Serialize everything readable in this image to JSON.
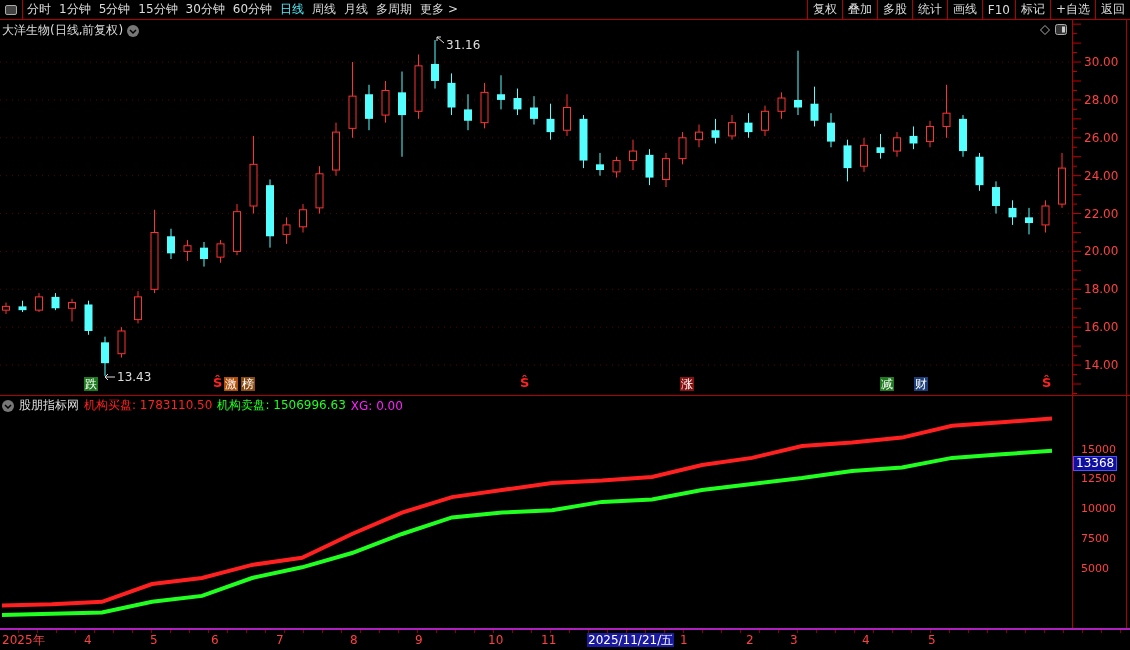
{
  "toolbar": {
    "tabs": [
      {
        "label": "分时",
        "selected": false
      },
      {
        "label": "1分钟",
        "selected": false
      },
      {
        "label": "5分钟",
        "selected": false
      },
      {
        "label": "15分钟",
        "selected": false
      },
      {
        "label": "30分钟",
        "selected": false
      },
      {
        "label": "60分钟",
        "selected": false
      },
      {
        "label": "日线",
        "selected": true
      },
      {
        "label": "周线",
        "selected": false
      },
      {
        "label": "月线",
        "selected": false
      },
      {
        "label": "多周期",
        "selected": false
      },
      {
        "label": "更多 >",
        "selected": false
      }
    ],
    "buttons": [
      "复权",
      "叠加",
      "多股",
      "统计",
      "画线",
      "F10",
      "标记",
      "+自选",
      "返回"
    ]
  },
  "price_panel": {
    "title": "大洋生物(日线,前复权)",
    "high_label": "31.16",
    "low_label": "13.43",
    "chart_data": {
      "type": "candlestick",
      "ylim": [
        12.42,
        32.22
      ],
      "grid": true,
      "yticks": [
        {
          "value": 30,
          "label": "30.00"
        },
        {
          "value": 28,
          "label": "28.00"
        },
        {
          "value": 26,
          "label": "26.00"
        },
        {
          "value": 24,
          "label": "24.00"
        },
        {
          "value": 22,
          "label": "22.00"
        },
        {
          "value": 20,
          "label": "20.00"
        },
        {
          "value": 18,
          "label": "18.00"
        },
        {
          "value": 16,
          "label": "16.00"
        },
        {
          "value": 14,
          "label": "14.00"
        }
      ],
      "ohlc": [
        [
          16.9,
          17.3,
          16.7,
          17.1
        ],
        [
          17.1,
          17.4,
          16.8,
          16.9
        ],
        [
          16.9,
          17.8,
          16.8,
          17.6
        ],
        [
          17.6,
          17.8,
          16.9,
          17.0
        ],
        [
          17.0,
          17.5,
          16.3,
          17.3
        ],
        [
          17.2,
          17.4,
          15.6,
          15.8
        ],
        [
          15.2,
          15.5,
          13.43,
          14.1
        ],
        [
          14.6,
          16.0,
          14.4,
          15.8
        ],
        [
          16.4,
          17.9,
          16.2,
          17.6
        ],
        [
          18.0,
          22.2,
          17.8,
          21.0
        ],
        [
          20.8,
          21.2,
          19.6,
          19.9
        ],
        [
          20.0,
          20.6,
          19.5,
          20.3
        ],
        [
          20.2,
          20.5,
          19.2,
          19.6
        ],
        [
          19.7,
          20.6,
          19.4,
          20.4
        ],
        [
          20.0,
          22.5,
          19.8,
          22.1
        ],
        [
          22.4,
          26.1,
          22.0,
          24.6
        ],
        [
          23.5,
          23.8,
          20.2,
          20.8
        ],
        [
          20.9,
          21.8,
          20.4,
          21.4
        ],
        [
          21.3,
          22.5,
          21.0,
          22.2
        ],
        [
          22.3,
          24.5,
          22.0,
          24.1
        ],
        [
          24.3,
          26.8,
          24.0,
          26.3
        ],
        [
          26.5,
          30.0,
          26.0,
          28.2
        ],
        [
          28.3,
          28.8,
          26.4,
          27.0
        ],
        [
          27.2,
          29.0,
          26.8,
          28.5
        ],
        [
          28.4,
          29.5,
          25.0,
          27.2
        ],
        [
          27.4,
          30.4,
          27.0,
          29.8
        ],
        [
          29.9,
          31.16,
          28.6,
          29.0
        ],
        [
          28.9,
          29.4,
          27.2,
          27.6
        ],
        [
          27.5,
          28.3,
          26.4,
          26.9
        ],
        [
          26.8,
          28.9,
          26.5,
          28.4
        ],
        [
          28.3,
          29.3,
          27.5,
          28.0
        ],
        [
          28.1,
          28.6,
          27.2,
          27.5
        ],
        [
          27.6,
          28.2,
          26.7,
          27.0
        ],
        [
          27.0,
          27.8,
          25.9,
          26.3
        ],
        [
          26.4,
          28.3,
          26.1,
          27.6
        ],
        [
          27.0,
          27.2,
          24.4,
          24.8
        ],
        [
          24.6,
          25.2,
          24.0,
          24.3
        ],
        [
          24.2,
          25.0,
          23.9,
          24.8
        ],
        [
          24.8,
          25.9,
          24.3,
          25.3
        ],
        [
          25.1,
          25.4,
          23.5,
          23.9
        ],
        [
          23.8,
          25.2,
          23.4,
          24.9
        ],
        [
          24.9,
          26.3,
          24.6,
          26.0
        ],
        [
          25.9,
          26.7,
          25.5,
          26.3
        ],
        [
          26.4,
          27.0,
          25.7,
          26.0
        ],
        [
          26.1,
          27.2,
          25.9,
          26.8
        ],
        [
          26.8,
          27.3,
          26.0,
          26.3
        ],
        [
          26.4,
          27.7,
          26.1,
          27.4
        ],
        [
          27.4,
          28.4,
          27.0,
          28.1
        ],
        [
          28.0,
          30.6,
          27.2,
          27.6
        ],
        [
          27.8,
          28.7,
          26.6,
          26.9
        ],
        [
          26.8,
          27.3,
          25.5,
          25.8
        ],
        [
          25.6,
          25.9,
          23.7,
          24.4
        ],
        [
          24.5,
          26.0,
          24.2,
          25.6
        ],
        [
          25.5,
          26.2,
          24.9,
          25.2
        ],
        [
          25.3,
          26.3,
          25.0,
          26.0
        ],
        [
          26.1,
          26.6,
          25.4,
          25.7
        ],
        [
          25.8,
          26.9,
          25.5,
          26.6
        ],
        [
          26.6,
          28.8,
          26.0,
          27.3
        ],
        [
          27.0,
          27.2,
          25.0,
          25.3
        ],
        [
          25.0,
          25.2,
          23.2,
          23.5
        ],
        [
          23.4,
          23.7,
          22.0,
          22.4
        ],
        [
          22.3,
          22.7,
          21.4,
          21.8
        ],
        [
          21.8,
          22.3,
          20.9,
          21.5
        ],
        [
          21.4,
          22.7,
          21.0,
          22.4
        ],
        [
          22.5,
          25.2,
          22.3,
          24.4
        ]
      ]
    },
    "signals": [
      {
        "text": "跌",
        "kind": "badge",
        "color": "#1e7a1e"
      },
      {
        "text": "Ŝ",
        "kind": "sign",
        "color": "#ff2020"
      },
      {
        "text": "激",
        "kind": "badge",
        "color": "#b0500a"
      },
      {
        "text": "榜",
        "kind": "badge",
        "color": "#8a4a10"
      },
      {
        "text": "Ŝ",
        "kind": "sign",
        "color": "#ff2020"
      },
      {
        "text": "涨",
        "kind": "badge",
        "color": "#8a1010"
      },
      {
        "text": "减",
        "kind": "badge",
        "color": "#1e7a1e"
      },
      {
        "text": "财",
        "kind": "badge",
        "color": "#1c3f7a"
      },
      {
        "text": "Ŝ",
        "kind": "sign",
        "color": "#ff2020"
      }
    ]
  },
  "indicator_panel": {
    "name": "股朋指标网",
    "legend": [
      {
        "text": "机构买盘: 1783110.50",
        "color": "#ff2020"
      },
      {
        "text": "机构卖盘: 1506996.63",
        "color": "#20ff20"
      },
      {
        "text": "XG: 0.00",
        "color": "#ff20ff"
      }
    ],
    "current_value": "13368",
    "chart_data": {
      "type": "line",
      "ylim": [
        0,
        19500
      ],
      "yticks": [
        {
          "value": 15000,
          "label": "15000"
        },
        {
          "value": 12500,
          "label": "12500"
        },
        {
          "value": 10000,
          "label": "10000"
        },
        {
          "value": 7500,
          "label": "7500"
        },
        {
          "value": 5000,
          "label": "5000"
        }
      ],
      "series": [
        {
          "color": "#ff2020",
          "values": [
            1900,
            2000,
            2200,
            3700,
            4200,
            5300,
            5900,
            7900,
            9700,
            11000,
            11600,
            12200,
            12400,
            12700,
            13700,
            14300,
            15300,
            15600,
            16000,
            17000,
            17300,
            17600
          ]
        },
        {
          "color": "#20ff20",
          "values": [
            1100,
            1200,
            1300,
            2200,
            2700,
            4200,
            5100,
            6300,
            7900,
            9300,
            9700,
            9900,
            10600,
            10800,
            11600,
            12100,
            12600,
            13200,
            13500,
            14300,
            14600,
            14900
          ]
        }
      ]
    }
  },
  "date_axis": [
    {
      "label": "2025年",
      "selected": false
    },
    {
      "label": "4",
      "selected": false
    },
    {
      "label": "5",
      "selected": false
    },
    {
      "label": "6",
      "selected": false
    },
    {
      "label": "7",
      "selected": false
    },
    {
      "label": "8",
      "selected": false
    },
    {
      "label": "9",
      "selected": false
    },
    {
      "label": "10",
      "selected": false
    },
    {
      "label": "11",
      "selected": false
    },
    {
      "label": "2025/11/21/五",
      "selected": true
    },
    {
      "label": "1",
      "selected": false
    },
    {
      "label": "2",
      "selected": false
    },
    {
      "label": "3",
      "selected": false
    },
    {
      "label": "4",
      "selected": false
    },
    {
      "label": "5",
      "selected": false
    }
  ]
}
